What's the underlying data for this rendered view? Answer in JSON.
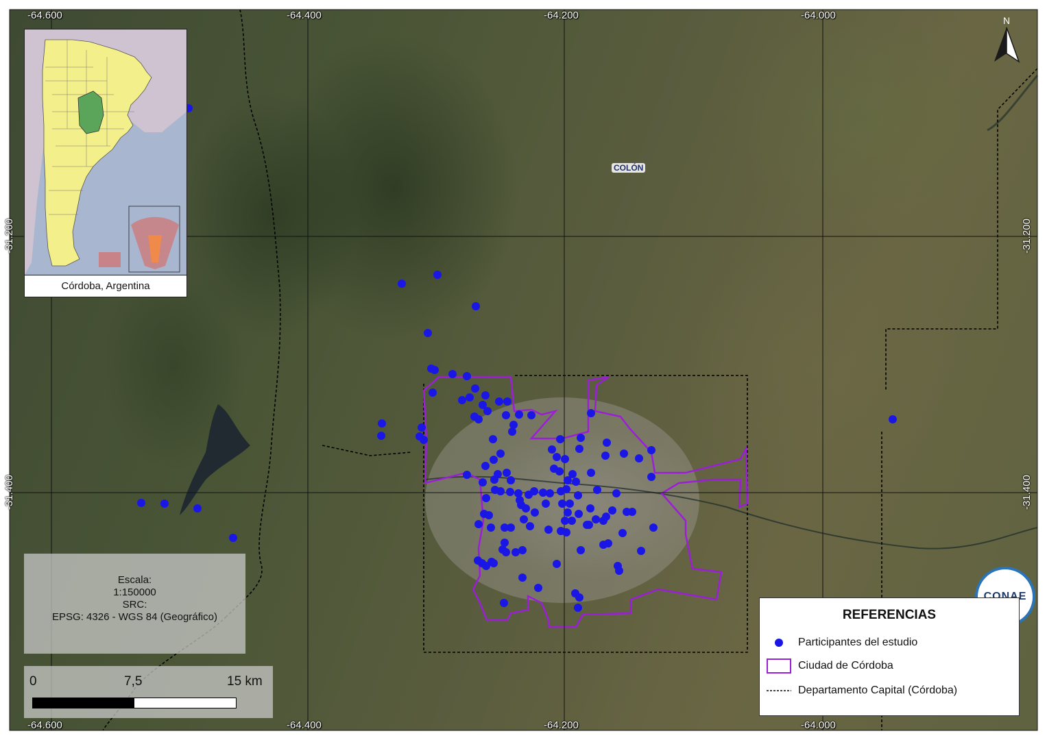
{
  "map": {
    "top_ticks": [
      "-64.600",
      "-64.400",
      "-64.200",
      "-64.000"
    ],
    "bottom_ticks": [
      "-64.600",
      "-64.400",
      "-64.200",
      "-64.000"
    ],
    "left_ticks": [
      "-31.200",
      "-31.400"
    ],
    "right_ticks": [
      "-31.200",
      "-31.400"
    ],
    "place_label": "COLÓN",
    "north_label": "N"
  },
  "inset": {
    "caption": "Córdoba, Argentina",
    "highlight_color": "#5aa55a",
    "country_color": "#f3ef8a"
  },
  "scale_info": {
    "escala_label": "Escala:",
    "escala_value": "1:150000",
    "src_label": "SRC:",
    "src_value": "EPSG: 4326 - WGS 84 (Geográfico)"
  },
  "scalebar": {
    "label_0": "0",
    "label_mid": "7,5",
    "label_end": "15 km"
  },
  "legend": {
    "title": "REFERENCIAS",
    "items": [
      {
        "label": "Participantes del estudio",
        "symbol": "blue-dot",
        "color": "#1a17e6"
      },
      {
        "label": "Ciudad de Córdoba",
        "symbol": "purple-rectangle",
        "color": "#9a1fd6"
      },
      {
        "label": "Departamento Capital (Córdoba)",
        "symbol": "dashed-line",
        "color": "#000000"
      }
    ]
  },
  "logo": {
    "text": "CONAE"
  }
}
